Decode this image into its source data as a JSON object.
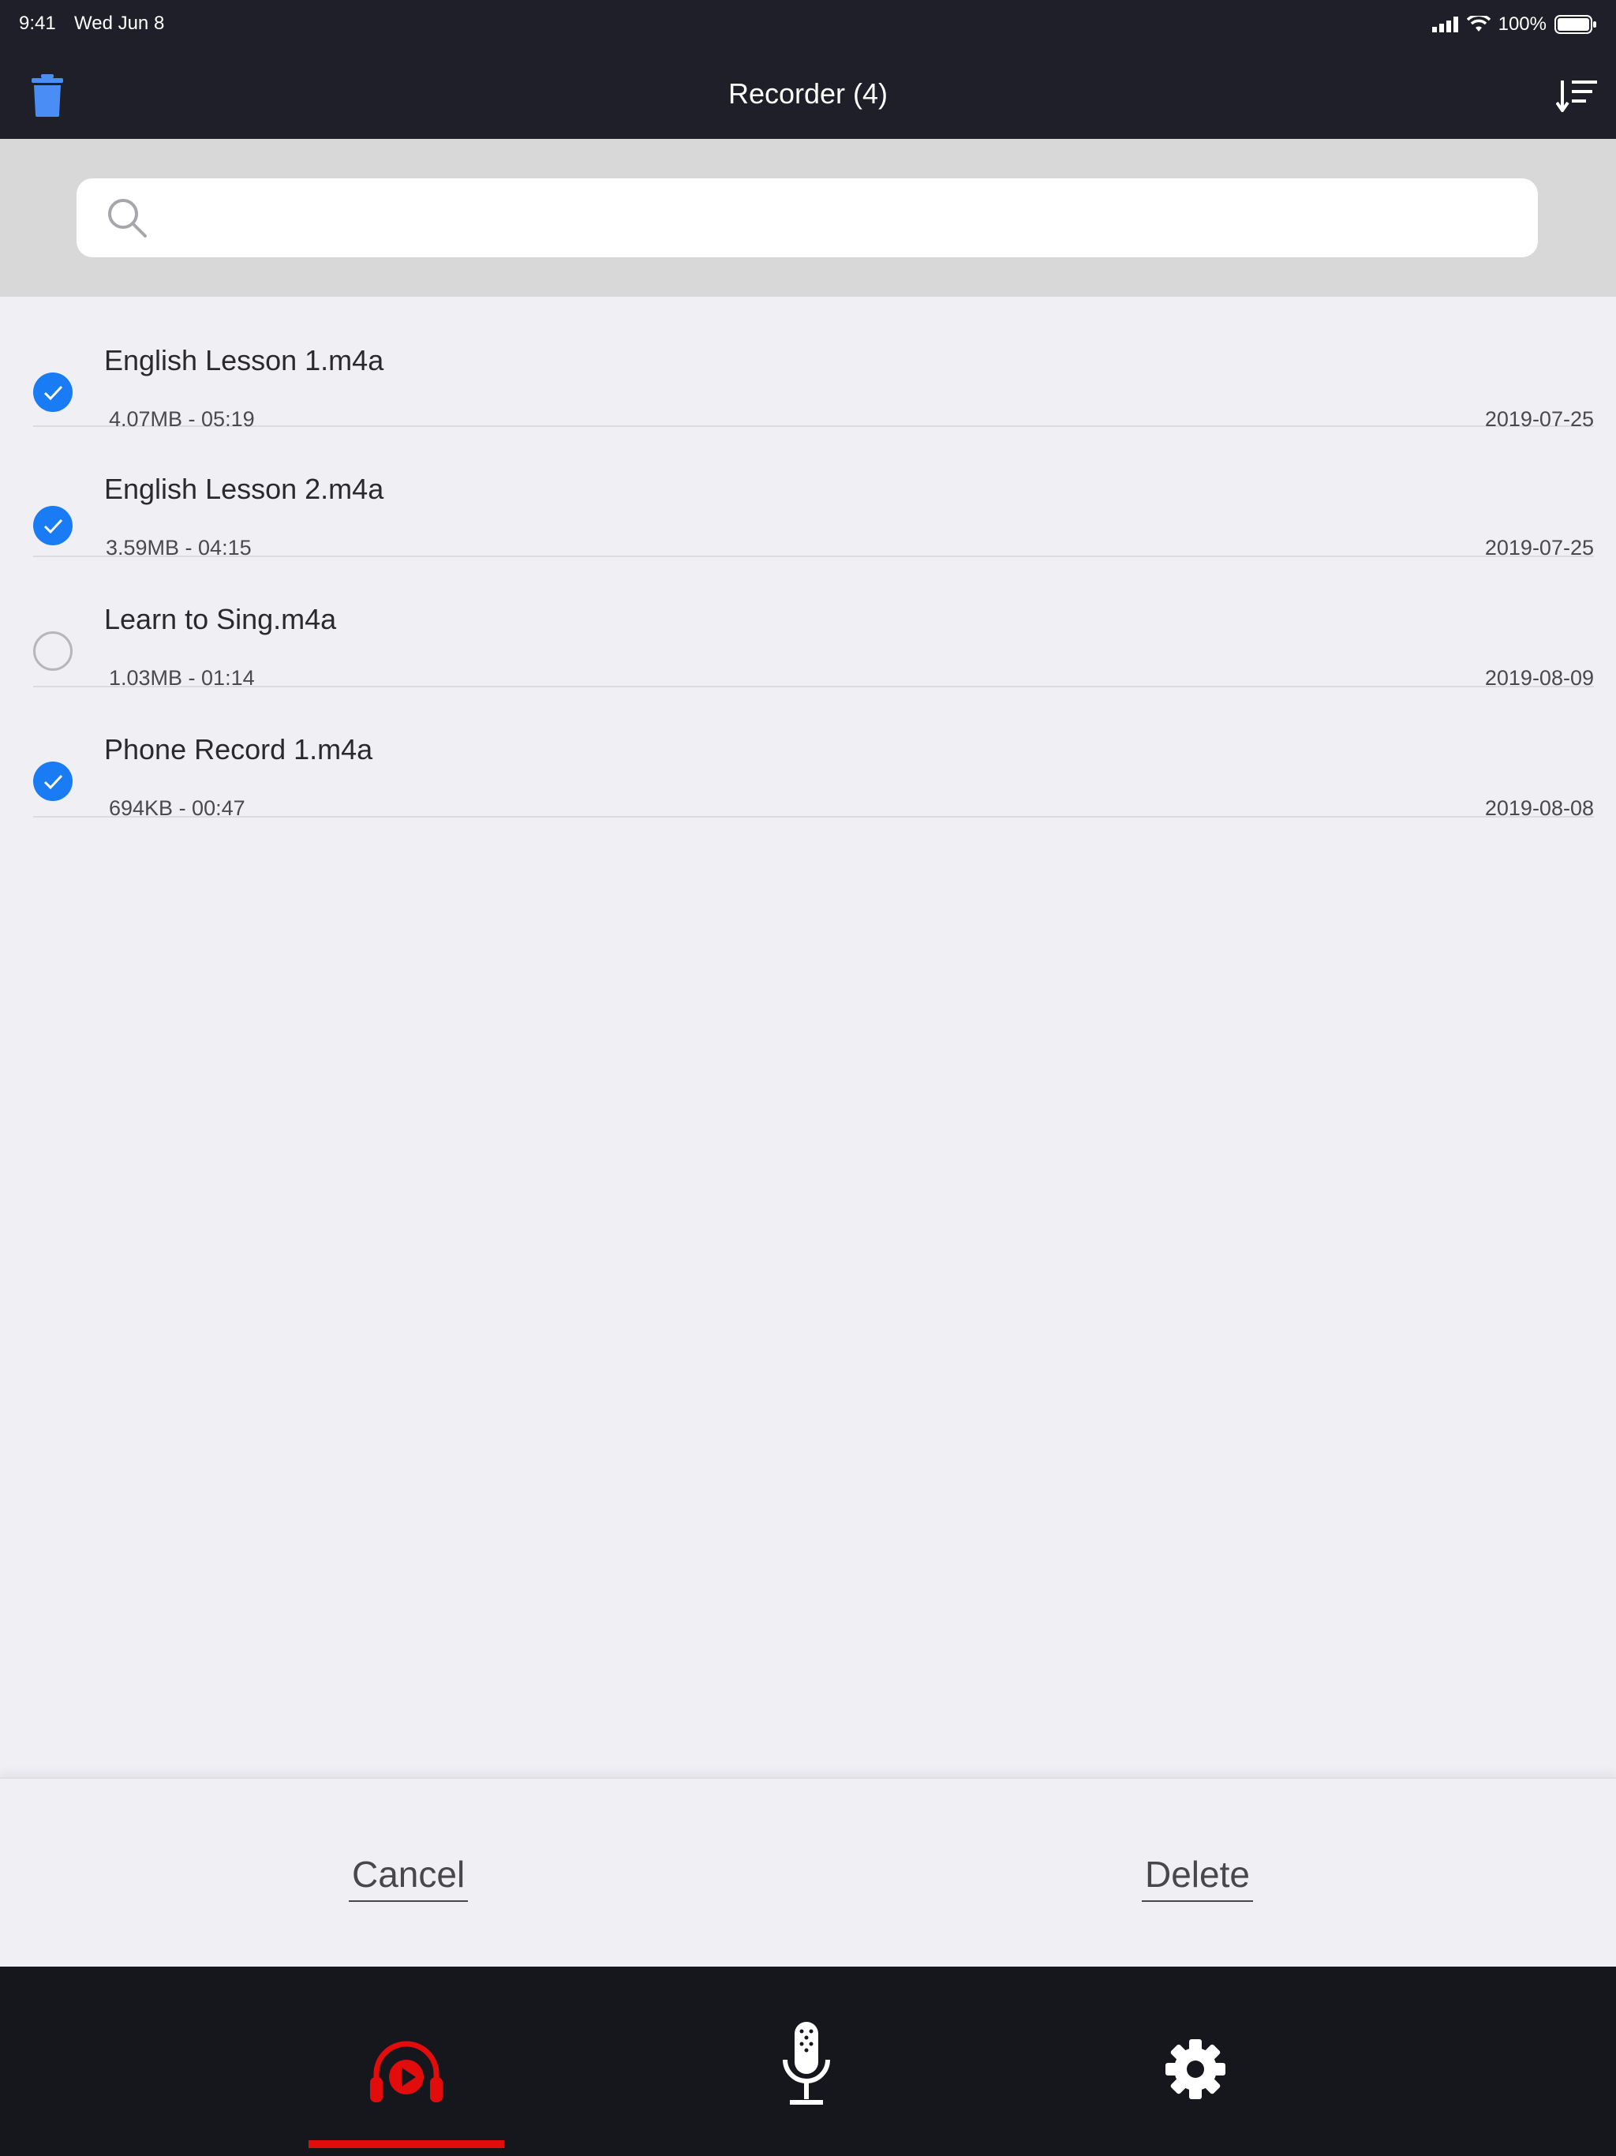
{
  "status_bar": {
    "time": "9:41",
    "date": "Wed Jun 8",
    "battery_percent": "100%"
  },
  "nav": {
    "title": "Recorder (4)",
    "trash_icon": "trash-icon",
    "sort_icon": "sort-icon"
  },
  "search": {
    "placeholder": "",
    "value": ""
  },
  "files": [
    {
      "name": "English Lesson 1.m4a",
      "meta": "4.07MB - 05:19",
      "date": "2019-07-25",
      "checked": true
    },
    {
      "name": "English Lesson 2.m4a",
      "meta": "3.59MB - 04:15",
      "date": "2019-07-25",
      "checked": true
    },
    {
      "name": "Learn to Sing.m4a",
      "meta": "1.03MB - 01:14",
      "date": "2019-08-09",
      "checked": false
    },
    {
      "name": "Phone Record 1.m4a",
      "meta": "694KB - 00:47",
      "date": "2019-08-08",
      "checked": true
    }
  ],
  "actions": {
    "cancel_label": "Cancel",
    "delete_label": "Delete"
  },
  "tabs": [
    {
      "name": "player",
      "icon": "headphones-play-icon",
      "active": true
    },
    {
      "name": "record",
      "icon": "microphone-icon",
      "active": false
    },
    {
      "name": "settings",
      "icon": "gear-icon",
      "active": false
    }
  ],
  "colors": {
    "accent_blue": "#1a7cf5",
    "active_tab_red": "#e30c0c",
    "bar_dark": "#1f1f29",
    "tab_bar_dark": "#16161d",
    "trash_blue": "#4a8ef5"
  }
}
